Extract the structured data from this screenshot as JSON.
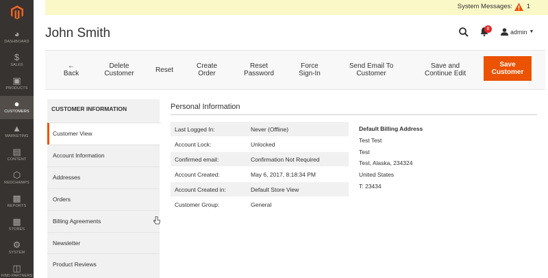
{
  "nav": {
    "items": [
      {
        "label": "Dashboard",
        "icon": "dashboard-icon"
      },
      {
        "label": "Sales",
        "icon": "dollar-icon"
      },
      {
        "label": "Products",
        "icon": "box-icon"
      },
      {
        "label": "Customers",
        "icon": "person-icon"
      },
      {
        "label": "Marketing",
        "icon": "megaphone-icon"
      },
      {
        "label": "Content",
        "icon": "content-icon"
      },
      {
        "label": "Redchamps",
        "icon": "hexagon-icon"
      },
      {
        "label": "Reports",
        "icon": "bar-chart-icon"
      },
      {
        "label": "Stores",
        "icon": "store-icon"
      },
      {
        "label": "System",
        "icon": "gear-icon"
      },
      {
        "label": "Find Partners",
        "icon": "partners-icon"
      }
    ],
    "active": "Customers"
  },
  "system_bar": {
    "label": "System Messages:",
    "count": "1"
  },
  "header": {
    "title": "John Smith",
    "notification_count": "8",
    "user": "admin"
  },
  "actions": {
    "back": "Back",
    "delete": "Delete\nCustomer",
    "reset": "Reset",
    "create_order": "Create\nOrder",
    "reset_password": "Reset\nPassword",
    "force_signin": "Force\nSign-In",
    "send_email": "Send Email To\nCustomer",
    "save_continue": "Save and\nContinue Edit",
    "save": "Save\nCustomer"
  },
  "tabs": {
    "heading": "Customer Information",
    "items": [
      "Customer View",
      "Account Information",
      "Addresses",
      "Orders",
      "Billing Agreements",
      "Newsletter",
      "Product Reviews"
    ]
  },
  "personal": {
    "title": "Personal Information",
    "rows": [
      {
        "k": "Last Logged In:",
        "v": "Never (Offline)"
      },
      {
        "k": "Account Lock:",
        "v": "Unlocked"
      },
      {
        "k": "Confirmed email:",
        "v": "Confirmation Not Required"
      },
      {
        "k": "Account Created:",
        "v": "May 6, 2017, 8:18:34 PM"
      },
      {
        "k": "Account Created in:",
        "v": "Default Store View"
      },
      {
        "k": "Customer Group:",
        "v": "General"
      }
    ]
  },
  "billing": {
    "heading": "Default Billing Address",
    "lines": [
      "Test Test",
      "Test",
      "Test, Alaska, 234324",
      "United States",
      "T: 23434"
    ]
  },
  "colors": {
    "accent": "#eb5202",
    "nav_bg": "#373330",
    "notice_bg": "#fbf8c8"
  }
}
